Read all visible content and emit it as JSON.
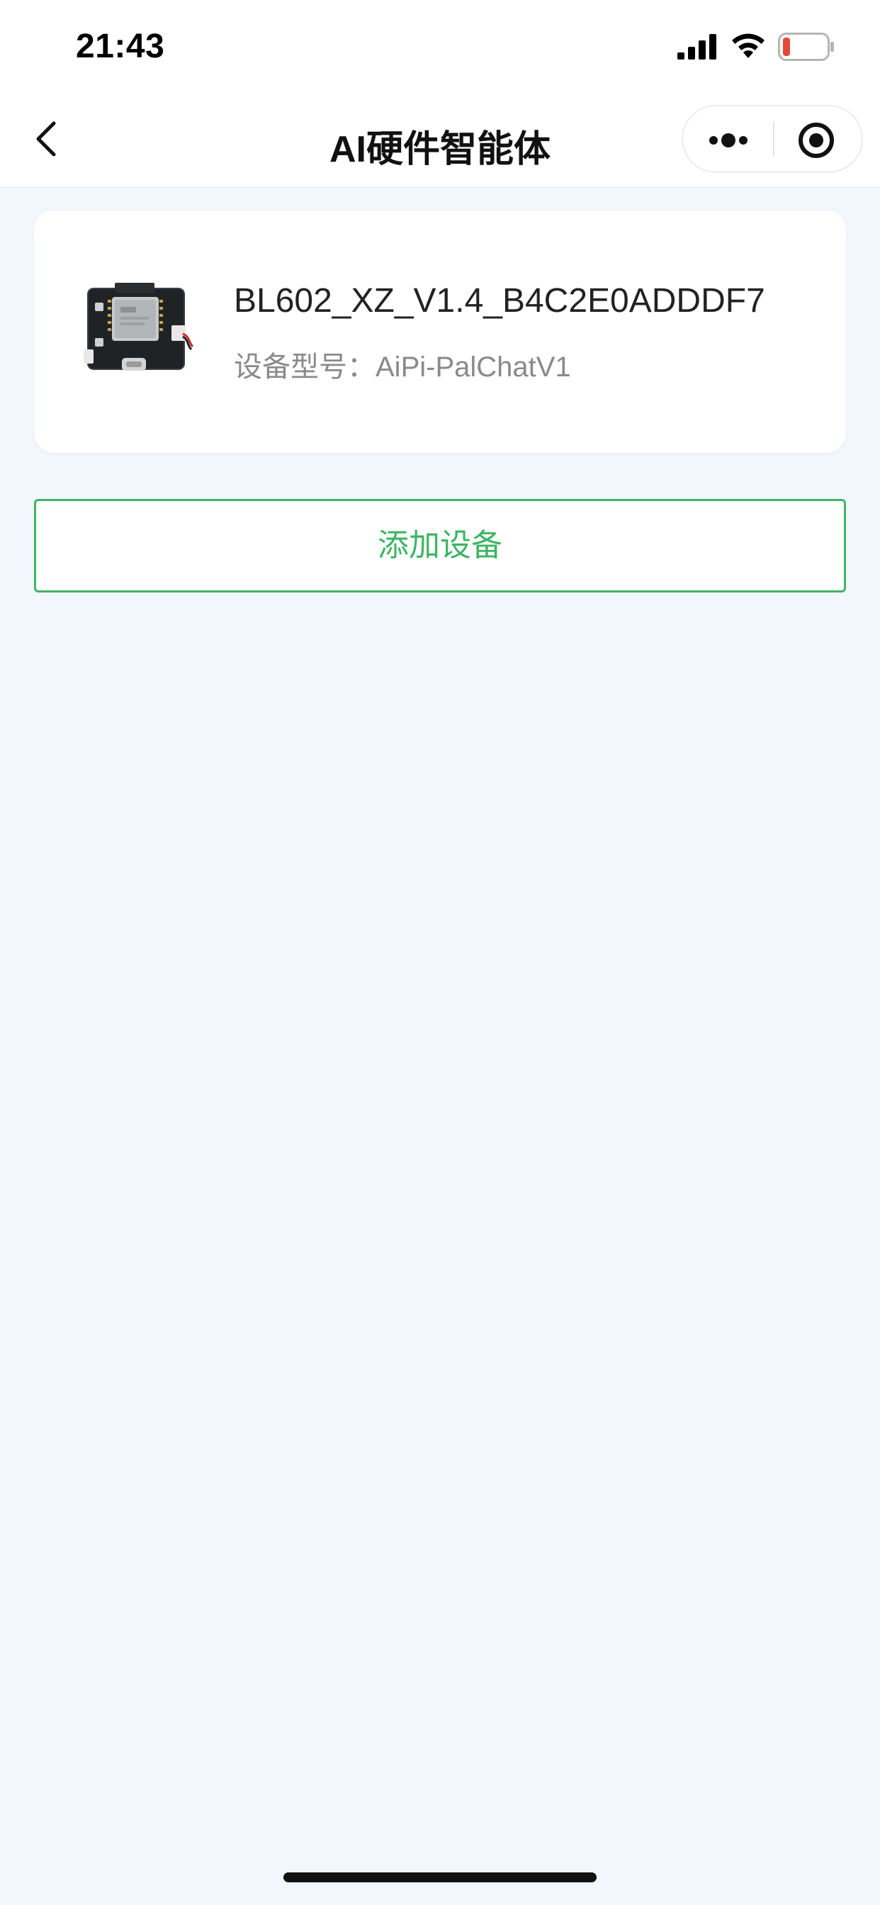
{
  "status_bar": {
    "time": "21:43",
    "icons": [
      "signal-icon",
      "wifi-icon",
      "battery-low-icon"
    ]
  },
  "nav": {
    "title": "AI硬件智能体",
    "back_icon": "chevron-left-icon",
    "more_icon": "more-dots-icon",
    "close_icon": "target-close-icon"
  },
  "device": {
    "name": "BL602_XZ_V1.4_B4C2E0ADDDF7",
    "model_label": "设备型号：",
    "model_value": "AiPi-PalChatV1",
    "image": "circuit-board-image"
  },
  "actions": {
    "add_device_label": "添加设备"
  },
  "colors": {
    "accent": "#3fb465",
    "page_background": "#f2f6fd",
    "battery_low": "#e5483b"
  }
}
